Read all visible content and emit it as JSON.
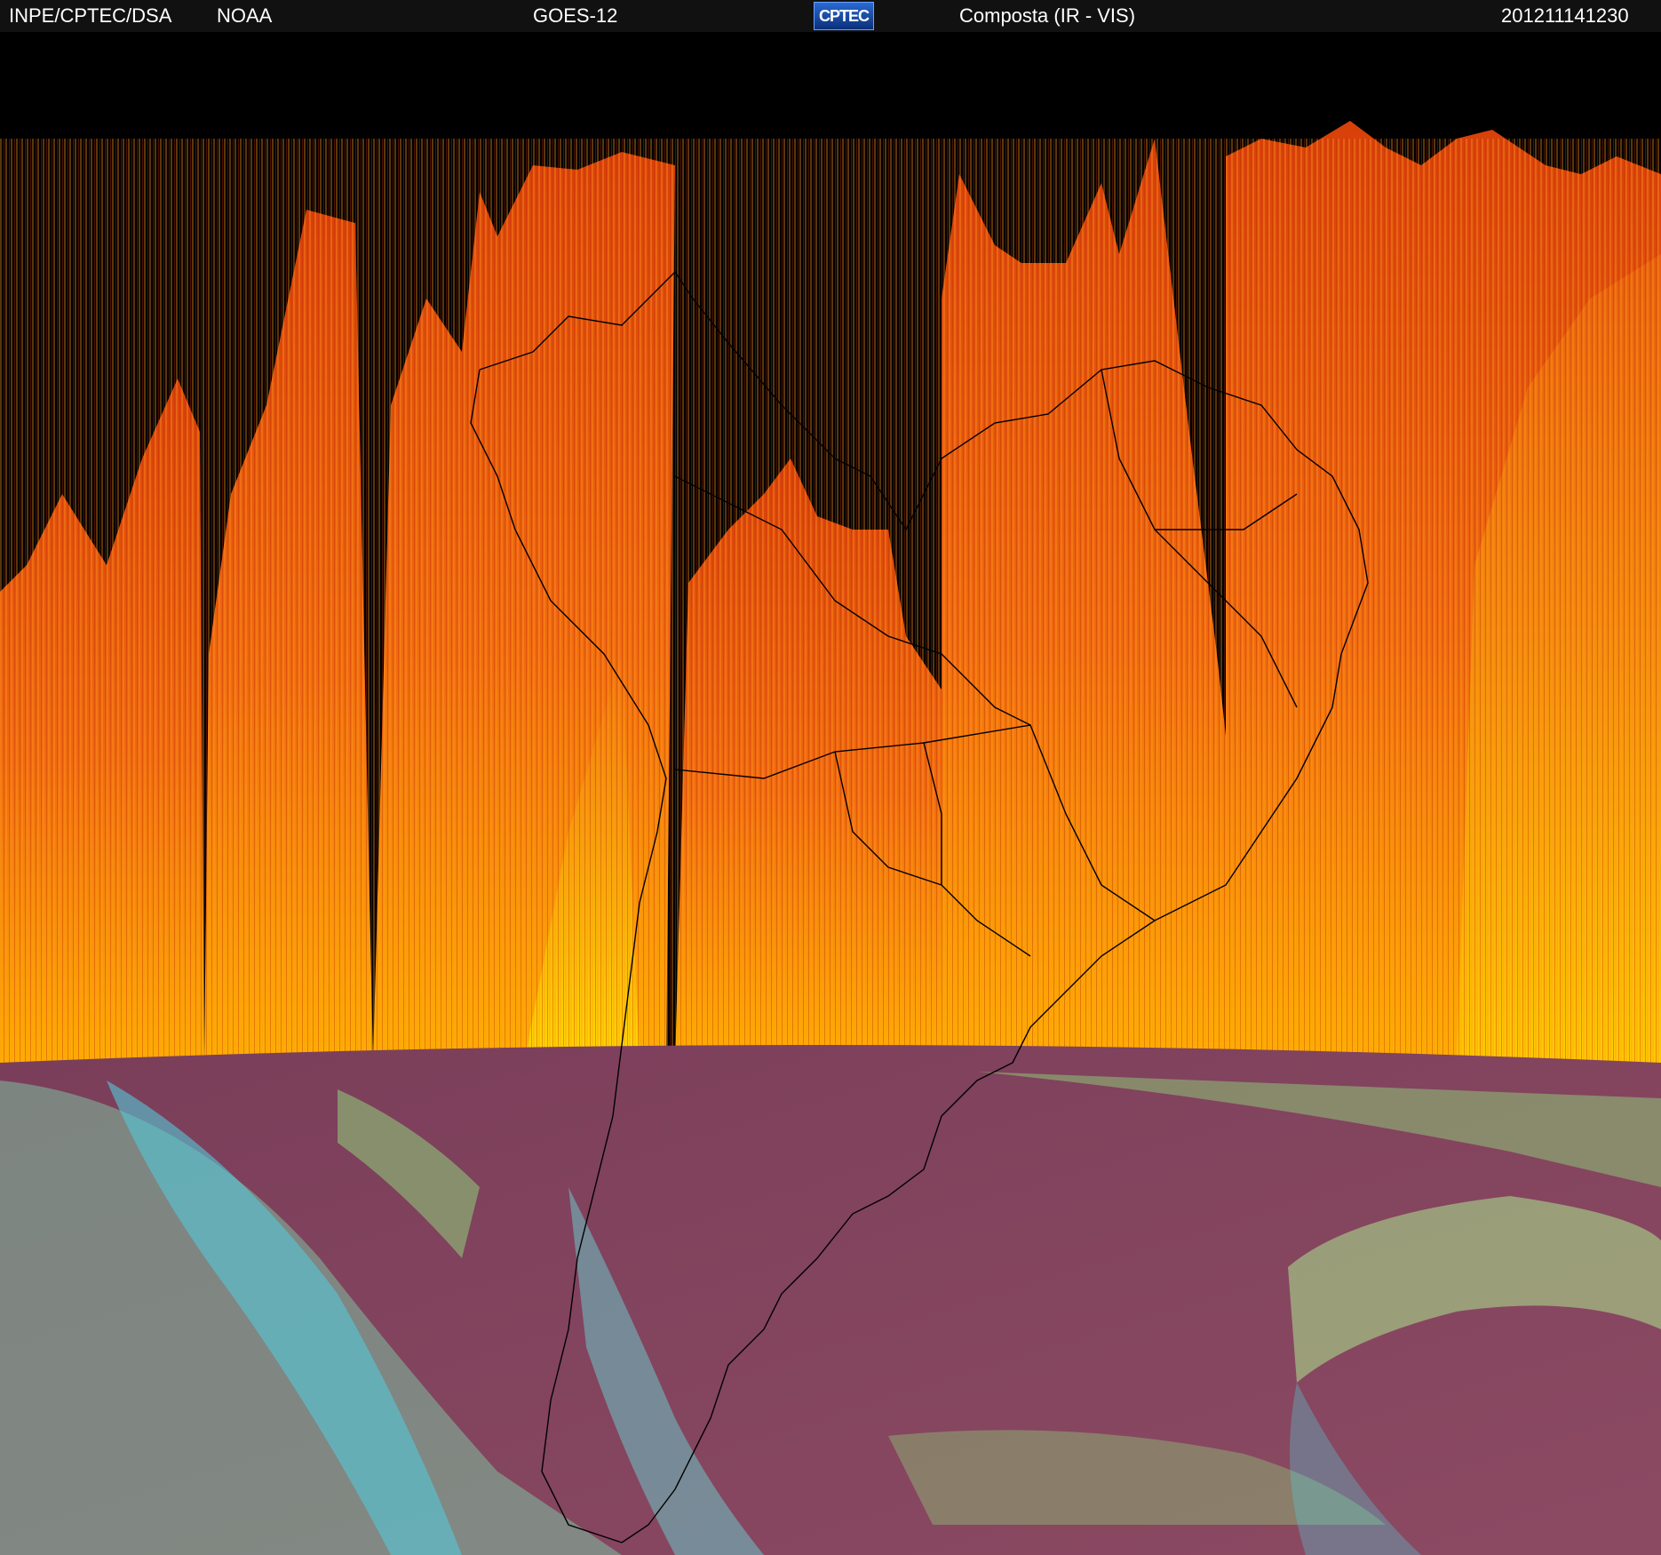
{
  "header": {
    "source": "INPE/CPTEC/DSA",
    "agency": "NOAA",
    "satellite": "GOES-12",
    "logo_text": "CPTEC",
    "product": "Composta (IR - VIS)",
    "timestamp": "201211141230"
  },
  "colors": {
    "header_bg": "#111111",
    "ir_dark": "#d8400a",
    "ir_mid": "#f06a10",
    "ir_bright": "#ffd000",
    "vis_surface": "#8a4060",
    "vis_cloud_green": "#8fcf7a",
    "vis_cloud_cyan": "#55c8d8",
    "coastline": "#000000"
  }
}
